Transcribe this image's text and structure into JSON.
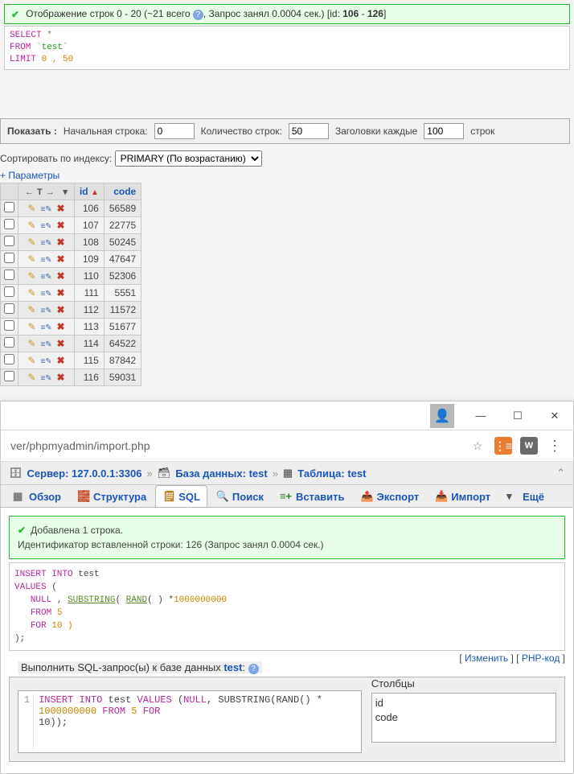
{
  "banner": {
    "text_prefix": "Отображение строк 0 - 20 (~21 всего ",
    "text_mid": ", Запрос занял 0.0004 сек.) [id: ",
    "id_from": "106",
    "id_to": "126",
    "text_suffix": "]"
  },
  "sql1": {
    "l1a": "SELECT",
    "l1b": " *",
    "l2a": "FROM",
    "l2b": " `",
    "l2c": "test",
    "l2d": "`",
    "l3a": "LIMIT",
    "l3b": " 0 , 50"
  },
  "controls": {
    "show_label": "Показать :",
    "start_label": "Начальная строка:",
    "start_value": "0",
    "count_label": "Количество строк:",
    "count_value": "50",
    "every_label": "Заголовки каждые",
    "every_value": "100",
    "rows_label": "строк"
  },
  "sort": {
    "label": "Сортировать по индексу:",
    "value": "PRIMARY (По возрастанию)"
  },
  "params_link": "+ Параметры",
  "columns": {
    "id": "id",
    "code": "code"
  },
  "rows": [
    {
      "id": "106",
      "code": "56589"
    },
    {
      "id": "107",
      "code": "22775"
    },
    {
      "id": "108",
      "code": "50245"
    },
    {
      "id": "109",
      "code": "47647"
    },
    {
      "id": "110",
      "code": "52306"
    },
    {
      "id": "111",
      "code": "5551"
    },
    {
      "id": "112",
      "code": "11572"
    },
    {
      "id": "113",
      "code": "51677"
    },
    {
      "id": "114",
      "code": "64522"
    },
    {
      "id": "115",
      "code": "87842"
    },
    {
      "id": "116",
      "code": "59031"
    }
  ],
  "window": {
    "url": "ver/phpmyadmin/import.php",
    "ext_w": "W"
  },
  "crumbs": {
    "server_label": "Сервер: ",
    "server_value": "127.0.0.1:3306",
    "db_label": "База данных: ",
    "db_value": "test",
    "table_label": "Таблица: ",
    "table_value": "test"
  },
  "tabs": {
    "browse": "Обзор",
    "structure": "Структура",
    "sql": "SQL",
    "search": "Поиск",
    "insert": "Вставить",
    "export": "Экспорт",
    "import": "Импорт",
    "more": "Ещё"
  },
  "banner2": {
    "line1": "Добавлена 1 строка.",
    "line2": "Идентификатор вставленной строки: 126 (Запрос занял 0.0004 сек.)"
  },
  "sql2": {
    "l1a": "INSERT",
    "l1b": " INTO",
    "l1c": " test",
    "l2a": "VALUES",
    "l2b": " (",
    "l3a": "NULL",
    "l3b": " , ",
    "l3c": "SUBSTRING",
    "l3d": "( ",
    "l3e": "RAND",
    "l3f": "( ) *",
    "l3g": "1000000000",
    "l4a": "FROM",
    "l4b": " 5",
    "l5a": "FOR",
    "l5b": " 10 )",
    "l6": ");"
  },
  "sqllinks": {
    "edit": "Изменить",
    "php": "PHP-код"
  },
  "runbox": {
    "legend_prefix": "Выполнить SQL-запрос(ы) к базе данных ",
    "legend_db": "test",
    "legend_suffix": ": ",
    "line_no": "1",
    "code_a": "INSERT",
    "code_b": " INTO",
    "code_c": " test ",
    "code_d": "VALUES",
    "code_e": " (",
    "code_f": "NULL",
    "code_g": ", ",
    "code_h": "SUBSTRING",
    "code_i": "(RAND() * ",
    "code_j": "1000000000",
    "code_k": " FROM",
    "code_l": " 5",
    "code_m": " FOR",
    "code_n": "10));",
    "cols_label": "Столбцы",
    "col1": "id",
    "col2": "code"
  }
}
